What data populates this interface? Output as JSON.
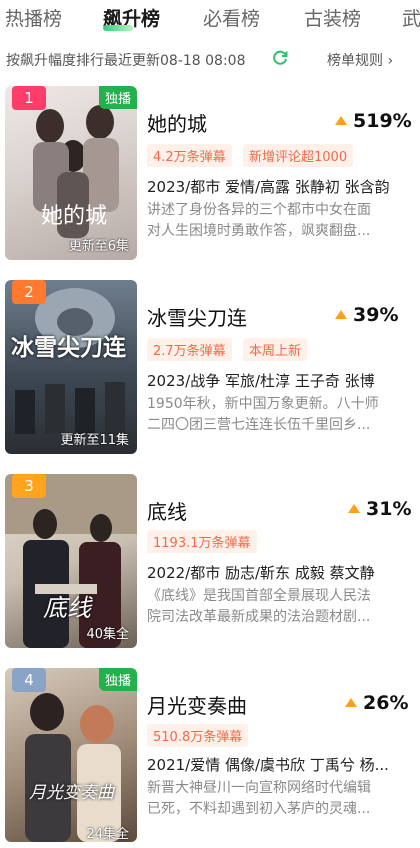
{
  "tabs": [
    "热播榜",
    "飙升榜",
    "必看榜",
    "古装榜",
    "武"
  ],
  "subbar": {
    "desc": "按飙升幅度排行最近更新08-18 08:08",
    "rules": "榜单规则 ›"
  },
  "items": [
    {
      "rank": "1",
      "rank_color": "#ff3d6b",
      "exclusive": "独播",
      "poster_text": "她的城",
      "episodes": "更新至6集",
      "title": "她的城",
      "rise": "519%",
      "tags": [
        "4.2万条弹幕",
        "新增评论超1000"
      ],
      "meta": "2023/都市 爱情/高露 张静初 张含韵",
      "summary_1": "讲述了身份各异的三个都市中女在面",
      "summary_2": "对人生困境时勇敢作答，飒爽翻盘..."
    },
    {
      "rank": "2",
      "rank_color": "#ff7a2f",
      "exclusive": "",
      "poster_text": "冰雪尖刀连",
      "episodes": "更新至11集",
      "title": "冰雪尖刀连",
      "rise": "39%",
      "tags": [
        "2.7万条弹幕",
        "本周上新"
      ],
      "meta": "2023/战争 军旅/杜淳 王子奇 张博",
      "summary_1": "1950年秋，新中国万象更新。八十师",
      "summary_2": "二四〇团三营七连连长伍千里回乡..."
    },
    {
      "rank": "3",
      "rank_color": "#ffa41c",
      "exclusive": "",
      "poster_text": "底线",
      "episodes": "40集全",
      "title": "底线",
      "rise": "31%",
      "tags": [
        "1193.1万条弹幕"
      ],
      "meta": "2022/都市 励志/靳东 成毅 蔡文静",
      "summary_1": "《底线》是我国首部全景展现人民法",
      "summary_2": "院司法改革最新成果的法治题材剧..."
    },
    {
      "rank": "4",
      "rank_color": "#8aa4c8",
      "exclusive": "独播",
      "poster_text": "月光变奏曲",
      "episodes": "24集全",
      "title": "月光变奏曲",
      "rise": "26%",
      "tags": [
        "510.8万条弹幕"
      ],
      "meta": "2021/爱情 偶像/虞书欣 丁禹兮 杨...",
      "summary_1": "新晋大神昼川一向宣称网络时代编辑",
      "summary_2": "已死，不料却遇到初入茅庐的灵魂..."
    }
  ]
}
